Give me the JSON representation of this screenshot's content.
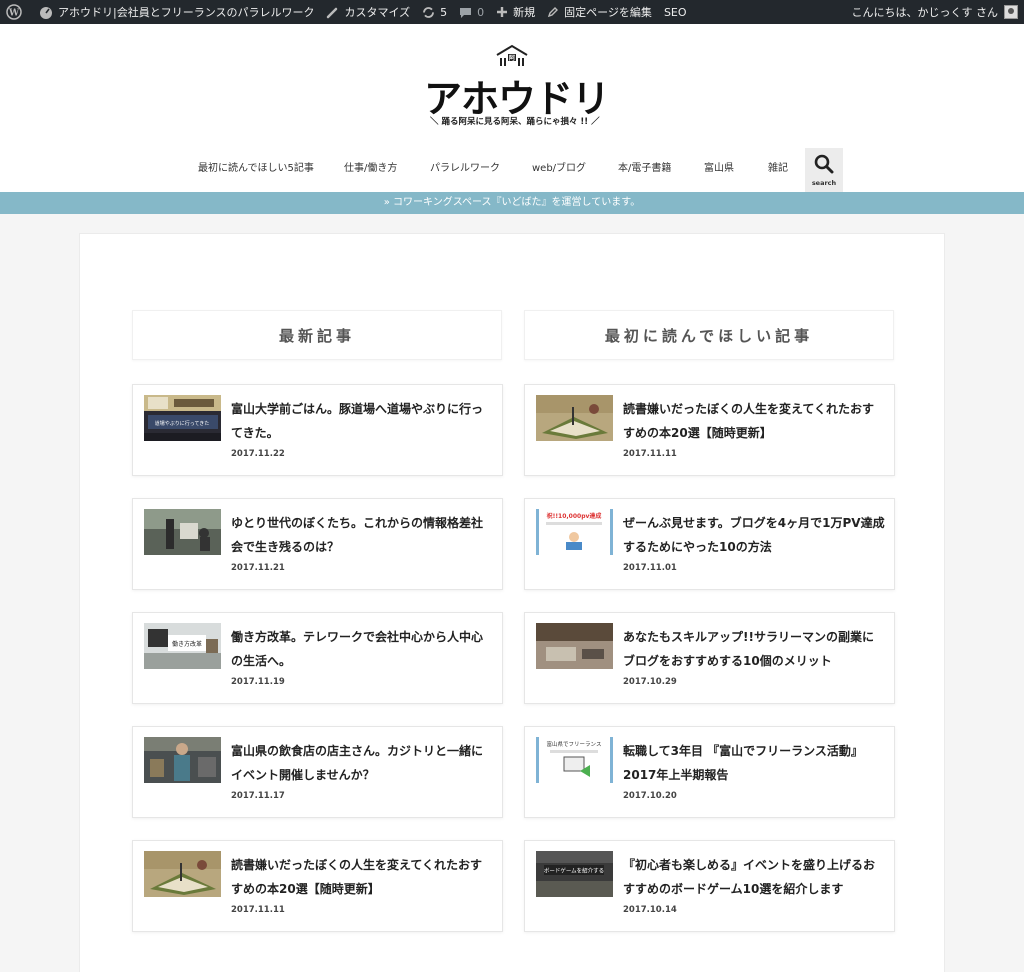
{
  "adminbar": {
    "site_name": "アホウドリ|会社員とフリーランスのパラレルワーク",
    "customize": "カスタマイズ",
    "updates": "5",
    "comments": "0",
    "new": "新規",
    "edit_page": "固定ページを編集",
    "seo": "SEO",
    "greeting": "こんにちは、かじっくす さん"
  },
  "header": {
    "logo_text": "アホウドリ",
    "logo_mark_text": "阿",
    "tagline": "＼ 踊る阿呆に見る阿呆、踊らにゃ損々 !! ／"
  },
  "nav": {
    "items": [
      {
        "label": "最初に読んでほしい5記事"
      },
      {
        "label": "仕事/働き方"
      },
      {
        "label": "パラレルワーク"
      },
      {
        "label": "web/ブログ"
      },
      {
        "label": "本/電子書籍"
      },
      {
        "label": "富山県"
      },
      {
        "label": "雑記"
      }
    ],
    "search_label": "search"
  },
  "infobar": {
    "text": "» コワーキングスペース『いどばた』を運営しています。"
  },
  "columns": {
    "left_title": "最新記事",
    "right_title": "最初に読んでほしい記事"
  },
  "latest_posts": [
    {
      "title": "富山大学前ごはん。豚道場へ道場やぶりに行ってきた。",
      "date": "2017.11.22"
    },
    {
      "title": "ゆとり世代のぼくたち。これからの情報格差社会で生き残るのは？",
      "date": "2017.11.21"
    },
    {
      "title": "働き方改革。テレワークで会社中心から人中心の生活へ。",
      "date": "2017.11.19"
    },
    {
      "title": "富山県の飲食店の店主さん。カジトリと一緒にイベント開催しませんか？",
      "date": "2017.11.17"
    },
    {
      "title": "読書嫌いだったぼくの人生を変えてくれたおすすめの本20選【随時更新】",
      "date": "2017.11.11"
    }
  ],
  "featured_posts": [
    {
      "title": "読書嫌いだったぼくの人生を変えてくれたおすすめの本20選【随時更新】",
      "date": "2017.11.11"
    },
    {
      "title": "ぜーんぶ見せます。ブログを4ヶ月で1万PV達成するためにやった10の方法",
      "date": "2017.11.01"
    },
    {
      "title": "あなたもスキルアップ!!サラリーマンの副業にブログをおすすめする10個のメリット",
      "date": "2017.10.29"
    },
    {
      "title": "転職して3年目 『富山でフリーランス活動』2017年上半期報告",
      "date": "2017.10.20"
    },
    {
      "title": "『初心者も楽しめる』イベントを盛り上げるおすすめのボードゲーム10選を紹介します",
      "date": "2017.10.14"
    }
  ],
  "thumbs": {
    "t1_text": "道場やぶりに行ってきた",
    "t3_text": "働き方改革",
    "t6_text": "祝!!10,000pv達成",
    "t8_text": "富山県でフリーランス",
    "t10_text": "ボードゲームを紹介する"
  },
  "colors": {
    "adminbar_bg": "#23282d",
    "infobar_bg": "#85b8c8",
    "accent_blue": "#7fb3d5"
  },
  "icons": [
    "wordpress-icon",
    "brush-icon",
    "update-icon",
    "comment-icon",
    "plus-icon",
    "edit-icon",
    "search-icon",
    "avatar-icon"
  ]
}
